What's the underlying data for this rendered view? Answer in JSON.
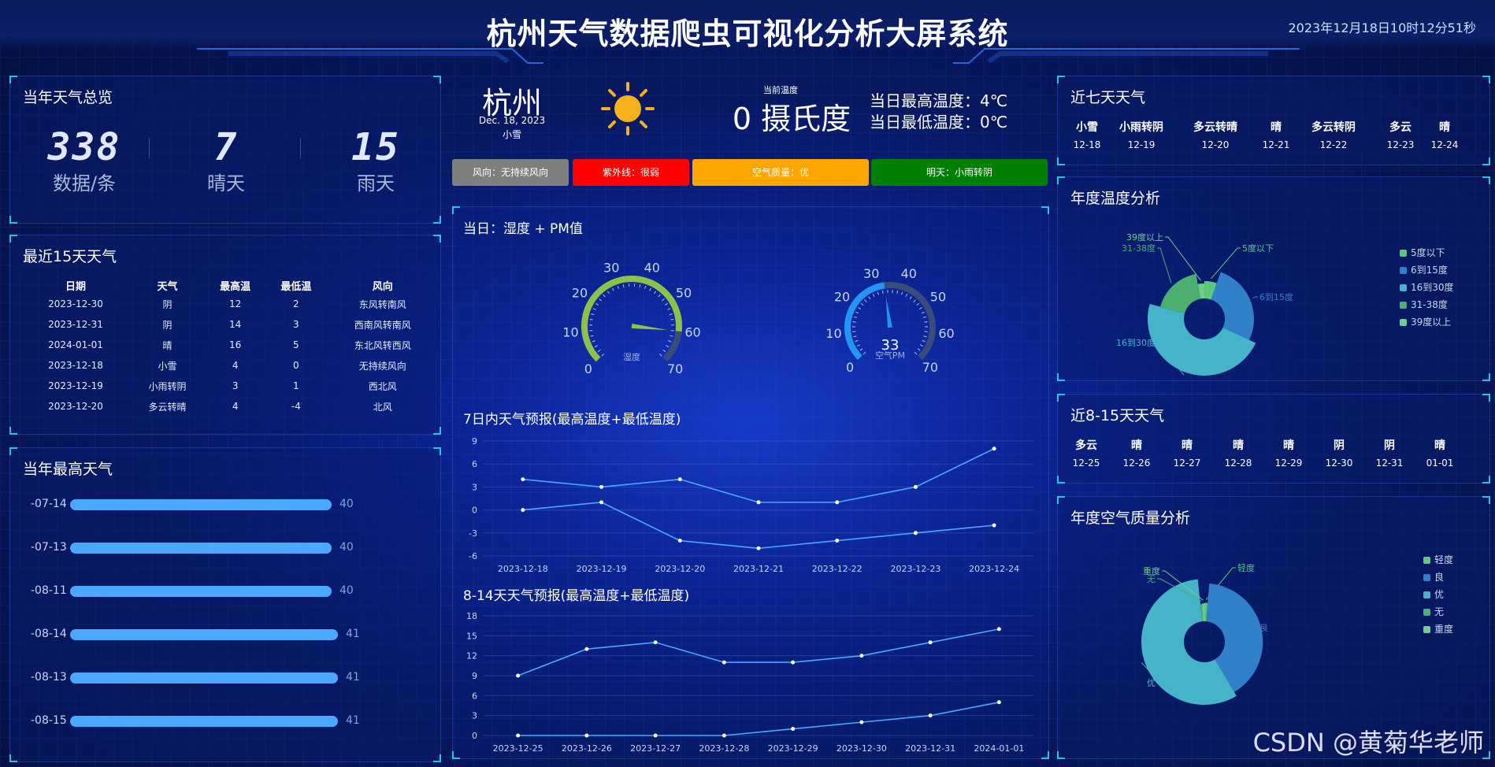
{
  "header": {
    "title": "杭州天气数据爬虫可视化分析大屏系统",
    "datetime": "2023年12月18日10时12分51秒"
  },
  "overview": {
    "title": "当年天气总览",
    "items": [
      {
        "value": "338",
        "label": "数据/条"
      },
      {
        "value": "7",
        "label": "晴天"
      },
      {
        "value": "15",
        "label": "雨天"
      }
    ]
  },
  "recent15": {
    "title": "最近15天天气",
    "headers": [
      "日期",
      "天气",
      "最高温",
      "最低温",
      "风向"
    ],
    "rows": [
      [
        "2023-12-30",
        "阴",
        "12",
        "2",
        "东风转南风"
      ],
      [
        "2023-12-31",
        "阴",
        "14",
        "3",
        "西南风转南风"
      ],
      [
        "2024-01-01",
        "晴",
        "16",
        "5",
        "东北风转西风"
      ],
      [
        "2023-12-18",
        "小雪",
        "4",
        "0",
        "无持续风向"
      ],
      [
        "2023-12-19",
        "小雨转阴",
        "3",
        "1",
        "西北风"
      ],
      [
        "2023-12-20",
        "多云转晴",
        "4",
        "-4",
        "北风"
      ]
    ]
  },
  "hottest": {
    "title": "当年最高天气",
    "max": 41,
    "items": [
      {
        "label": "-07-14",
        "value": 40
      },
      {
        "label": "-07-13",
        "value": 40
      },
      {
        "label": "-08-11",
        "value": 40
      },
      {
        "label": "-08-14",
        "value": 41
      },
      {
        "label": "-08-13",
        "value": 41
      },
      {
        "label": "-08-15",
        "value": 41
      }
    ]
  },
  "current": {
    "city": "杭州",
    "date": "Dec. 18, 2023",
    "condition": "小雪",
    "temp_label": "当前温度",
    "temp": "0 摄氏度",
    "high": "当日最高温度：4℃",
    "low": "当日最低温度：0℃",
    "sun_icon": "sun-icon"
  },
  "tags": [
    {
      "text": "风向：无持续风向",
      "color": "#7f7f7f"
    },
    {
      "text": "紫外线：很弱",
      "color": "#ff0000"
    },
    {
      "text": "空气质量：优",
      "color": "#ffa500"
    },
    {
      "text": "明天：小雨转阴",
      "color": "#008000"
    }
  ],
  "gauges": {
    "title": "当日：湿度 + PM值",
    "humidity": {
      "label": "湿度",
      "value": 60,
      "min": 0,
      "max": 70,
      "ticks": [
        "0",
        "10",
        "20",
        "30",
        "40",
        "50",
        "60",
        "70"
      ],
      "color": "#8bc34a"
    },
    "pm": {
      "label": "空气PM",
      "value": 33,
      "min": 0,
      "max": 70,
      "ticks": [
        "0",
        "10",
        "20",
        "30",
        "40",
        "50",
        "60",
        "70"
      ],
      "color": "#2196f3"
    }
  },
  "forecast7": {
    "title": "7日内天气预报(最高温度+最低温度)",
    "chart_data": {
      "type": "line",
      "categories": [
        "2023-12-18",
        "2023-12-19",
        "2023-12-20",
        "2023-12-21",
        "2023-12-22",
        "2023-12-23",
        "2023-12-24"
      ],
      "series": [
        {
          "values": [
            4,
            3,
            4,
            1,
            1,
            3,
            8
          ]
        },
        {
          "values": [
            0,
            1,
            -4,
            -5,
            -4,
            -3,
            -2
          ]
        }
      ],
      "ylim": [
        -6,
        9
      ],
      "yticks": [
        "9",
        "6",
        "3",
        "0",
        "-3",
        "-6"
      ]
    }
  },
  "forecast8_14": {
    "title": "8-14天天气预报(最高温度+最低温度)",
    "chart_data": {
      "type": "line",
      "categories": [
        "2023-12-25",
        "2023-12-26",
        "2023-12-27",
        "2023-12-28",
        "2023-12-29",
        "2023-12-30",
        "2023-12-31",
        "2024-01-01"
      ],
      "series": [
        {
          "values": [
            9,
            13,
            14,
            11,
            11,
            12,
            14,
            16
          ]
        },
        {
          "values": [
            0,
            0,
            0,
            0,
            1,
            2,
            3,
            5
          ]
        }
      ],
      "ylim": [
        0,
        18
      ],
      "yticks": [
        "18",
        "15",
        "12",
        "9",
        "6",
        "3",
        "0"
      ]
    }
  },
  "week7": {
    "title": "近七天天气",
    "days": [
      {
        "w": "小雪",
        "d": "12-18"
      },
      {
        "w": "小雨转阴",
        "d": "12-19"
      },
      {
        "w": "多云转晴",
        "d": "12-20"
      },
      {
        "w": "晴",
        "d": "12-21"
      },
      {
        "w": "多云转阴",
        "d": "12-22"
      },
      {
        "w": "多云",
        "d": "12-23"
      },
      {
        "w": "晴",
        "d": "12-24"
      }
    ]
  },
  "week8_15": {
    "title": "近8-15天天气",
    "days": [
      {
        "w": "多云",
        "d": "12-25"
      },
      {
        "w": "晴",
        "d": "12-26"
      },
      {
        "w": "晴",
        "d": "12-27"
      },
      {
        "w": "晴",
        "d": "12-28"
      },
      {
        "w": "晴",
        "d": "12-29"
      },
      {
        "w": "阴",
        "d": "12-30"
      },
      {
        "w": "阴",
        "d": "12-31"
      },
      {
        "w": "晴",
        "d": "01-01"
      }
    ]
  },
  "tempAnalysis": {
    "title": "年度温度分析",
    "chart_data": {
      "type": "pie",
      "labels": [
        "5度以下",
        "6到15度",
        "16到30度",
        "31-38度",
        "39度以上"
      ],
      "values": [
        18,
        90,
        160,
        60,
        10
      ],
      "colors": [
        "#5cc87a",
        "#2f80c9",
        "#46b4c8",
        "#4caf70",
        "#6fcf8a"
      ]
    }
  },
  "airAnalysis": {
    "title": "年度空气质量分析",
    "chart_data": {
      "type": "pie",
      "labels": [
        "轻度",
        "良",
        "优",
        "无",
        "重度"
      ],
      "values": [
        4,
        120,
        170,
        2,
        3
      ],
      "colors": [
        "#5cc87a",
        "#2f80c9",
        "#46b4c8",
        "#4caf70",
        "#6fcf8a"
      ]
    }
  },
  "watermark": "CSDN @黄菊华老师"
}
